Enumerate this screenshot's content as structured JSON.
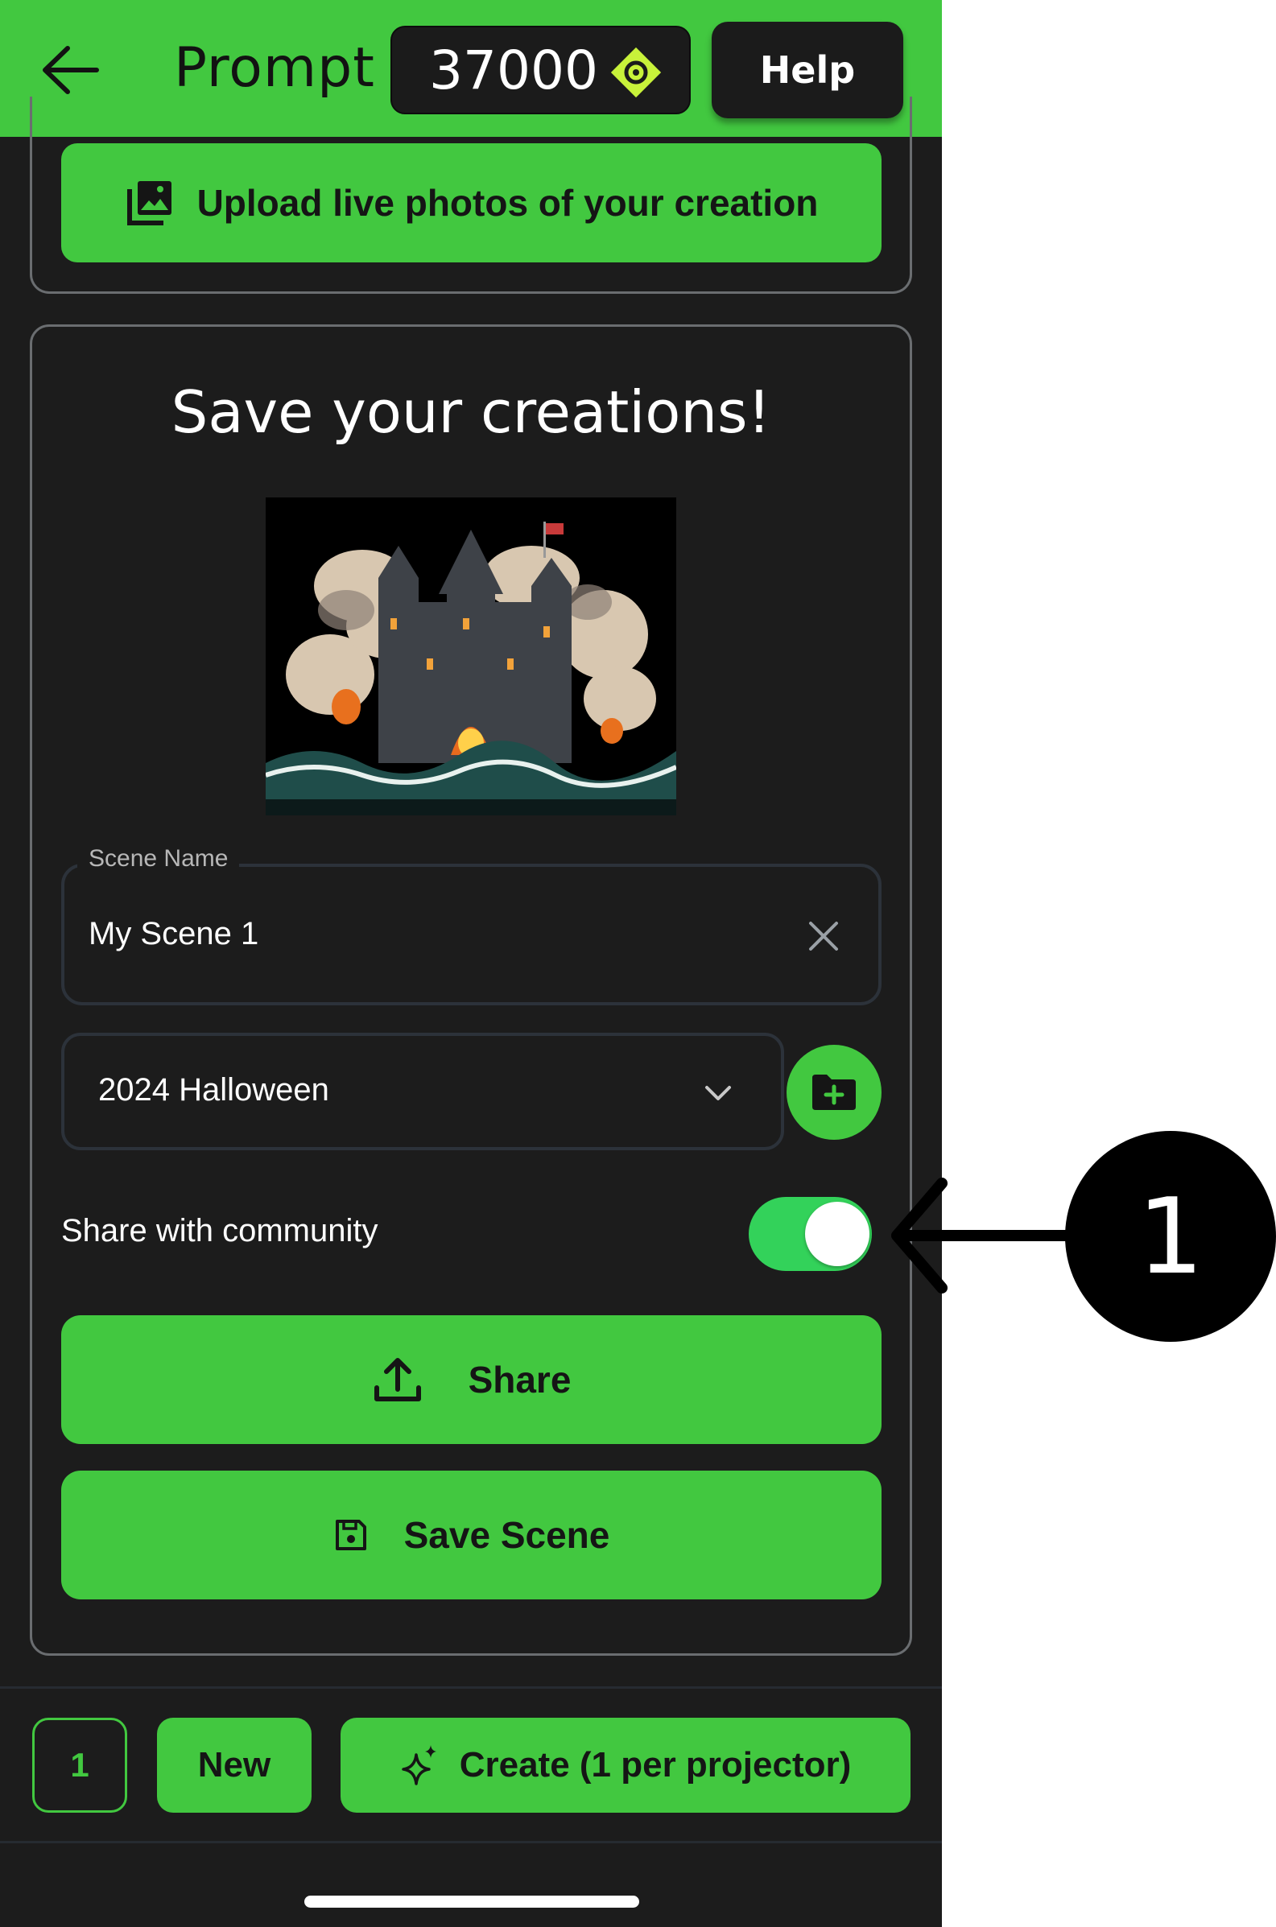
{
  "header": {
    "title": "Prompt",
    "credits": "37000",
    "credits_icon": "diamond-coin-icon",
    "help_label": "Help"
  },
  "upload": {
    "label": "Upload live photos of your creation",
    "icon": "photo-library-icon"
  },
  "save_card": {
    "title": "Save your creations!",
    "scene_name_label": "Scene Name",
    "scene_name_value": "My Scene 1",
    "folder_value": "2024 Halloween",
    "share_label": "Share with community",
    "share_enabled": true,
    "share_button": "Share",
    "save_button": "Save Scene"
  },
  "bottom_bar": {
    "count": "1",
    "new_label": "New",
    "create_label": "Create (1 per projector)"
  },
  "annotation": {
    "badge": "1"
  },
  "colors": {
    "accent": "#42c840",
    "background": "#1c1c1c",
    "toggle_on": "#33d25a"
  }
}
